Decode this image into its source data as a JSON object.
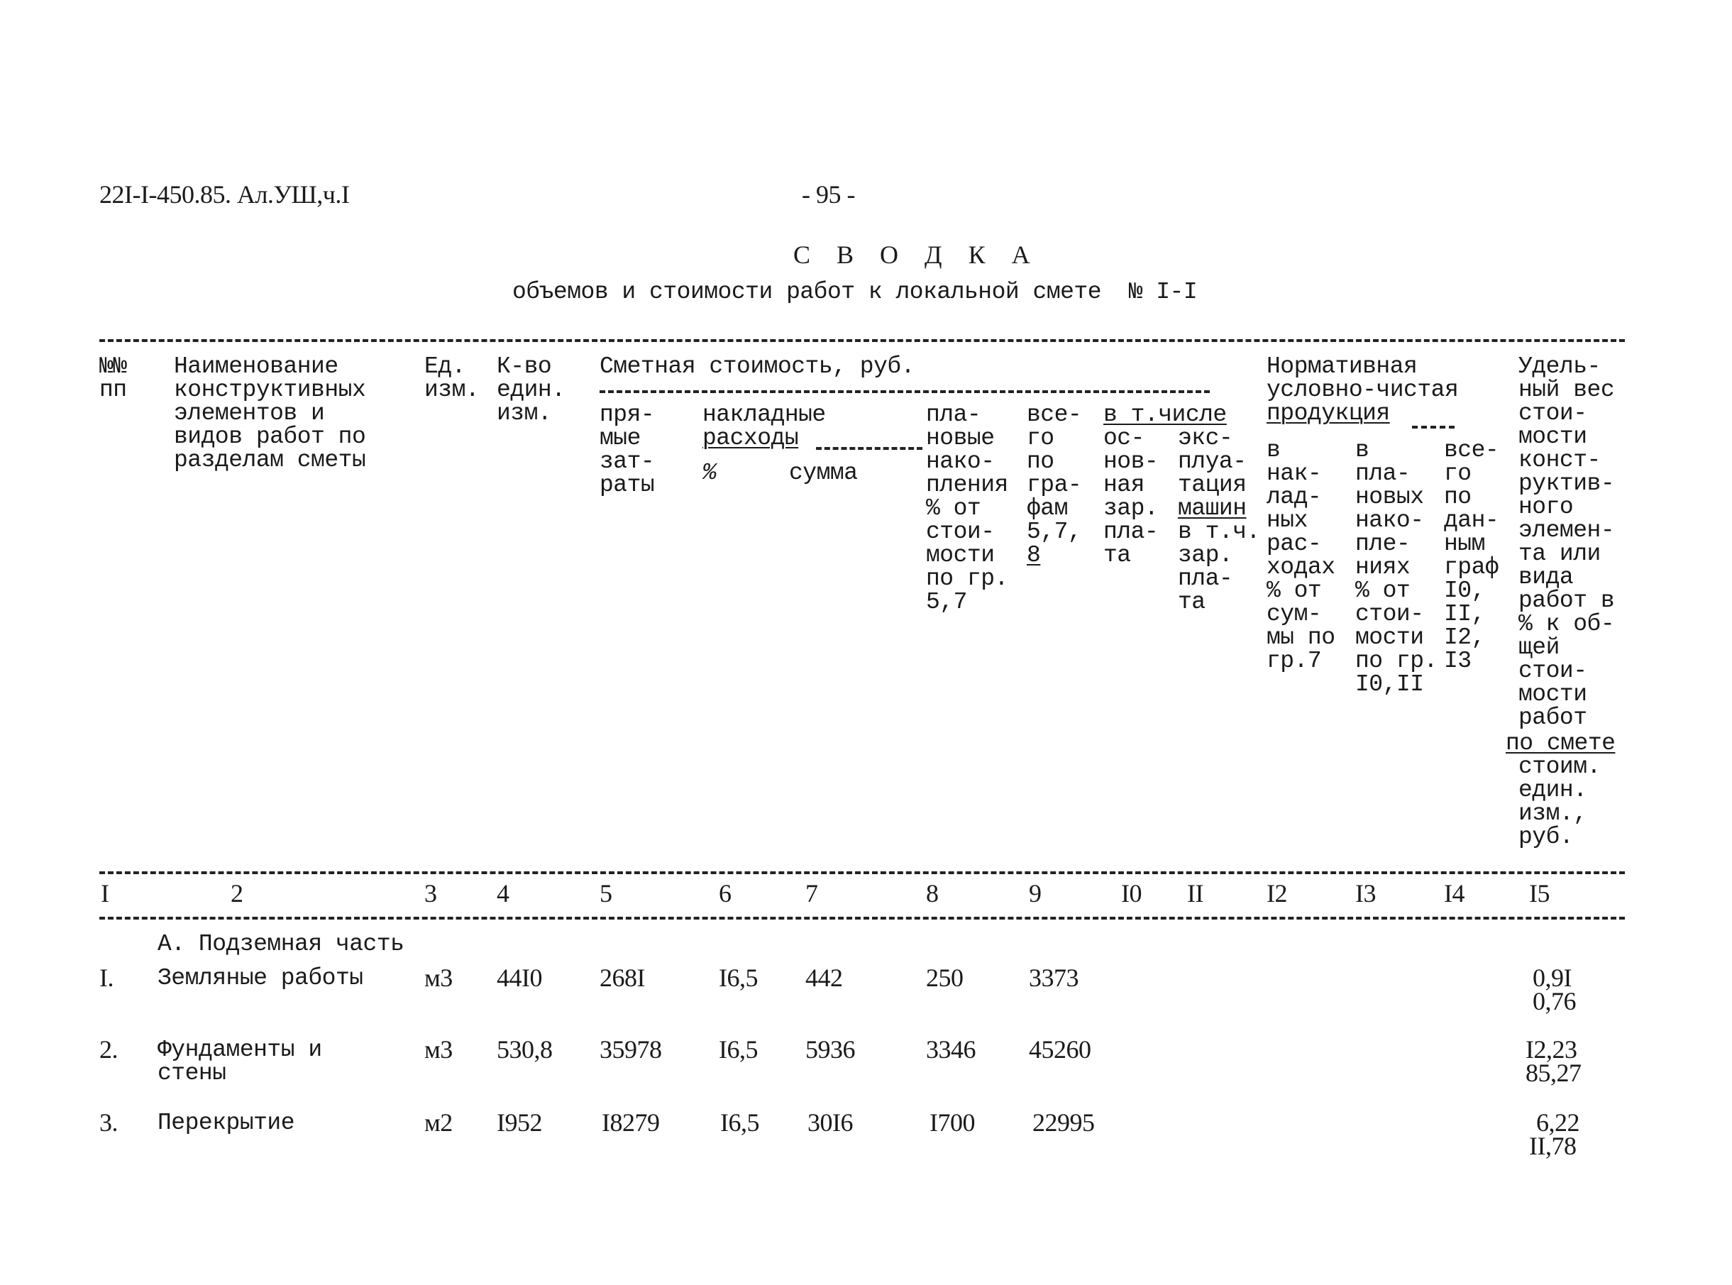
{
  "document": {
    "code": "22I-I-450.85. Ал.УШ,ч.I",
    "page_number": "- 95 -",
    "title": "С В О Д К А",
    "subtitle": "объемов и стоимости работ к локальной смете  № I-I"
  },
  "table": {
    "headers": {
      "col1": "№№\nпп",
      "col2": "Наименование\nконструктивных\nэлементов и\nвидов работ по\nразделам сметы",
      "col3": "Ед.\nизм.",
      "col4": "К-во\nедин.\nизм.",
      "group_cost": "Сметная стоимость, руб.",
      "col5": "пря-\nмые\nзат-\nраты",
      "group_overhead": "накладные",
      "group_overhead_2": "расходы",
      "col6": "%",
      "col7": "сумма",
      "col8": "пла-\nновые\nнако-\nпления\n% от\nстои-\nмости\nпо гр.\n5,7",
      "col9_a": "все-\nго\nпо\nгра-\nфам\n5,7,",
      "col9_b": "8",
      "group_incl": "в т.числе",
      "col10": "ос-\nнов-\nная\nзар.\nпла-\nта",
      "col11_a": "экс-\nплуа-\nтация",
      "col11_b": "машин",
      "col11_c": "в т.ч.\nзар.\nпла-\nта",
      "group_norm_a": "Нормативная\nусловно-чистая",
      "group_norm_b": "продукция",
      "col12": "в\nнак-\nлад-\nных\nрас-\nходах\n% от\nсум-\nмы по\nгр.7",
      "col13": "в\nпла-\nновых\nнако-\nпле-\nниях\n% от\nстои-\nмости\nпо гр.\nI0,II",
      "col14": "все-\nго\nпо\nдан-\nным\nграф\nI0,\nII,\nI2,\nI3",
      "col15_a": "Удель-\nный вес\nстои-\nмости\nконст-\nруктив-\nного\nэлемен-\nта или\nвида\nработ в\n% к об-\nщей\nстои-\nмости\nработ",
      "col15_b": "по смете",
      "col15_c": "стоим.\nедин.\nизм.,\nруб."
    },
    "column_numbers": [
      "I",
      "2",
      "3",
      "4",
      "5",
      "6",
      "7",
      "8",
      "9",
      "I0",
      "II",
      "I2",
      "I3",
      "I4",
      "I5"
    ],
    "section_title": "А. Подземная часть",
    "rows": [
      {
        "no": "I.",
        "name": "Земляные работы",
        "unit": "м3",
        "qty": "44I0",
        "direct": "268I",
        "overhead_pct": "I6,5",
        "overhead_sum": "442",
        "planned": "250",
        "total": "3373",
        "share": "0,9I",
        "unit_cost": "0,76"
      },
      {
        "no": "2.",
        "name": "Фундаменты и\nстены",
        "unit": "м3",
        "qty": "530,8",
        "direct": "35978",
        "overhead_pct": "I6,5",
        "overhead_sum": "5936",
        "planned": "3346",
        "total": "45260",
        "share": "I2,23",
        "unit_cost": "85,27"
      },
      {
        "no": "3.",
        "name": "Перекрытие",
        "unit": "м2",
        "qty": "I952",
        "direct": "I8279",
        "overhead_pct": "I6,5",
        "overhead_sum": "30I6",
        "planned": "I700",
        "total": "22995",
        "share": "6,22",
        "unit_cost": "II,78"
      }
    ]
  }
}
